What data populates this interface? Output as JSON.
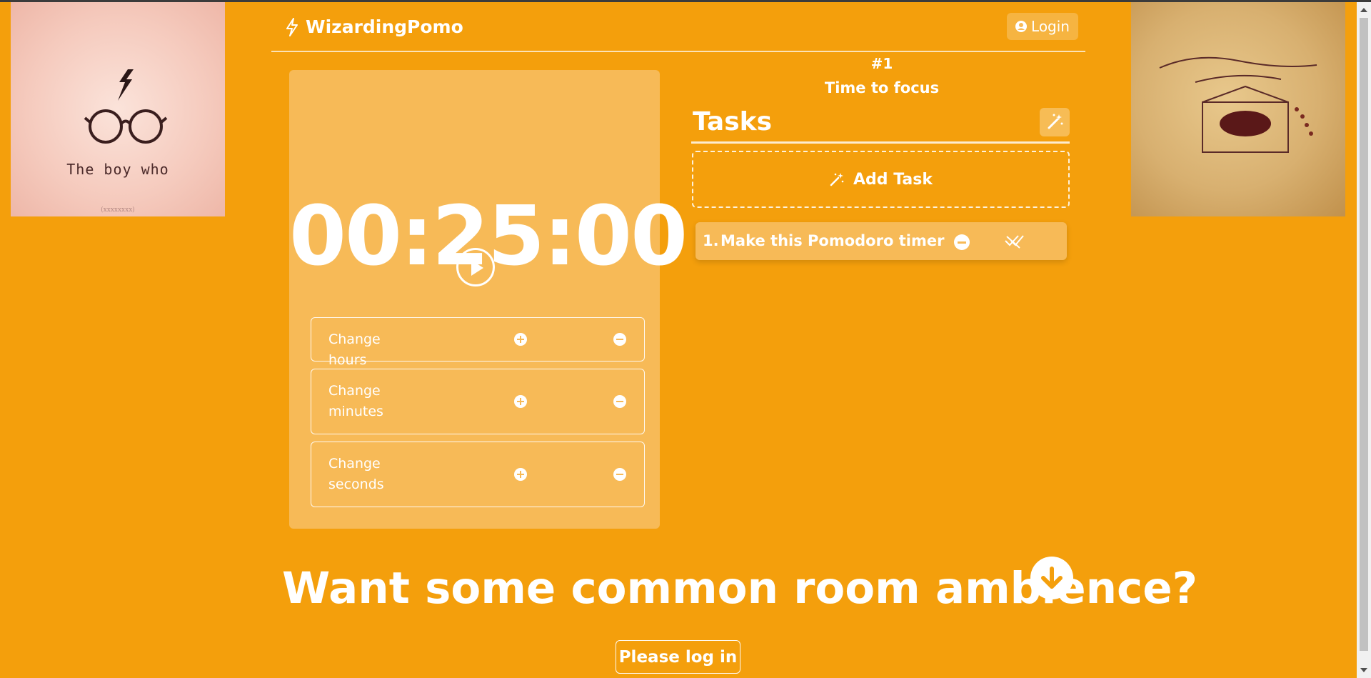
{
  "app": {
    "brand_name": "WizardingPomo",
    "login_label": "Login"
  },
  "left_image": {
    "caption": "The boy who",
    "signature": "(xxxxxxxx)"
  },
  "timer": {
    "display": "00:25:00",
    "adjusters": [
      {
        "label_line1": "Change hours",
        "label_line2": ""
      },
      {
        "label_line1": "Change",
        "label_line2": "minutes"
      },
      {
        "label_line1": "Change",
        "label_line2": "seconds"
      }
    ]
  },
  "session": {
    "number": "#1",
    "message": "Time to focus"
  },
  "tasks": {
    "title": "Tasks",
    "add_label": "Add Task",
    "items": [
      {
        "number": "1.",
        "text": "Make this Pomodoro timer"
      }
    ]
  },
  "ambience": {
    "heading": "Want some common room ambience?",
    "login_prompt": "Please log in"
  },
  "colors": {
    "background": "#F49F0C",
    "card": "#F7BA57",
    "text": "#FFFFFF"
  },
  "icons": {
    "brand": "lightning-icon",
    "login": "user-circle-icon",
    "play": "play-icon",
    "wand": "magic-wand-icon",
    "add_task": "wand-sparkle-icon",
    "remove": "minus-circle-icon",
    "done": "check-double-icon",
    "scroll_down": "arrow-down-circle-icon"
  }
}
